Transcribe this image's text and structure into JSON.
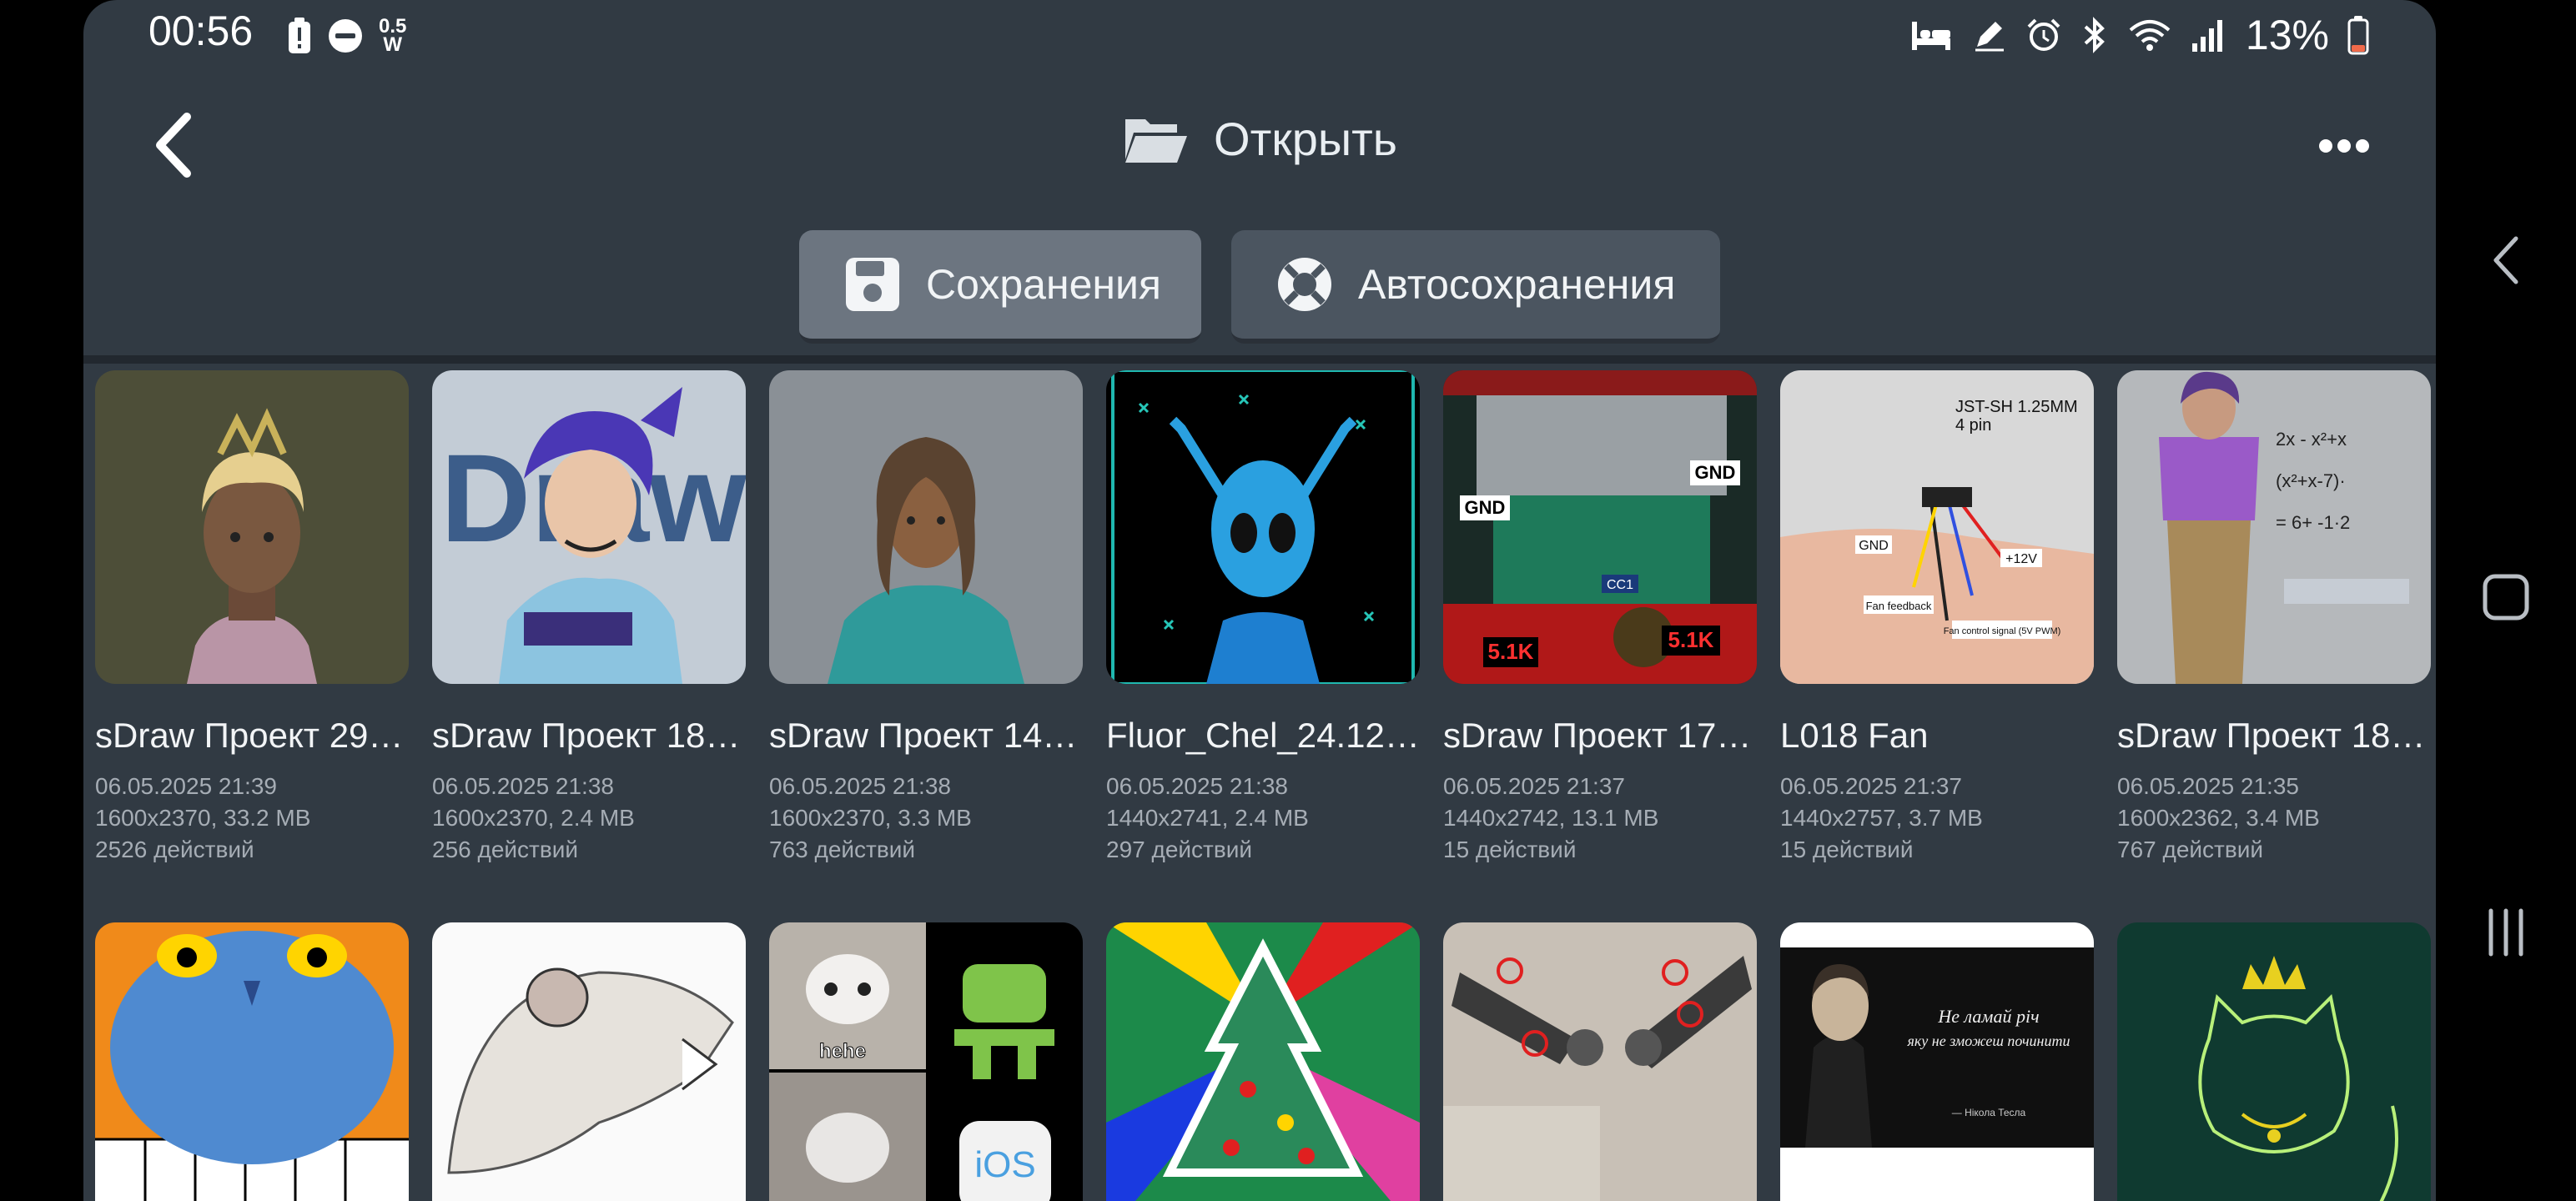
{
  "status": {
    "time": "00:56",
    "power_top": "0.5",
    "power_bottom": "W",
    "battery": "13%"
  },
  "header": {
    "title": "Открыть"
  },
  "tabs": [
    {
      "label": "Сохранения",
      "active": true
    },
    {
      "label": "Автосохранения",
      "active": false
    }
  ],
  "projects": [
    {
      "name": "sDraw Проект 29.…",
      "date": "06.05.2025 21:39",
      "size": "1600x2370, 33.2 MB",
      "actions": "2526 действий"
    },
    {
      "name": "sDraw Проект 18.…",
      "date": "06.05.2025 21:38",
      "size": "1600x2370, 2.4 MB",
      "actions": "256 действий"
    },
    {
      "name": "sDraw Проект 14.…",
      "date": "06.05.2025 21:38",
      "size": "1600x2370, 3.3 MB",
      "actions": "763 действий"
    },
    {
      "name": "Fluor_Chel_24.12.…",
      "date": "06.05.2025 21:38",
      "size": "1440x2741, 2.4 MB",
      "actions": "297 действий"
    },
    {
      "name": "sDraw Проект 17.…",
      "date": "06.05.2025 21:37",
      "size": "1440x2742, 13.1 MB",
      "actions": "15 действий"
    },
    {
      "name": "L018 Fan",
      "date": "06.05.2025 21:37",
      "size": "1440x2757, 3.7 MB",
      "actions": "15 действий"
    },
    {
      "name": "sDraw Проект 18.…",
      "date": "06.05.2025 21:35",
      "size": "1600x2362, 3.4 MB",
      "actions": "767 действий"
    }
  ],
  "thumb_texts": {
    "p2": "Draw",
    "p5_gnd1": "GND",
    "p5_gnd2": "GND",
    "p5_cc1": "CC1",
    "p5_r1": "5.1K",
    "p5_r2": "5.1K",
    "p6_conn": "JST-SH 1.25MM",
    "p6_pin": "4 pin",
    "p6_gnd": "GND",
    "p6_12v": "+12V",
    "p6_fb": "Fan feedback",
    "p6_ctrl": "Fan control signal (5V PWM)",
    "p7_math1": "2x - x²+x",
    "p7_math2": "(x²+x-7)·",
    "p7_math3": "= 6+ -1·2",
    "m3_hehe": "hehe",
    "m3_ios": "iOS",
    "m6_quote1": "Не ламай річ",
    "m6_quote2": "яку не зможеш починити",
    "m6_sign": "— Нікола Тесла"
  }
}
